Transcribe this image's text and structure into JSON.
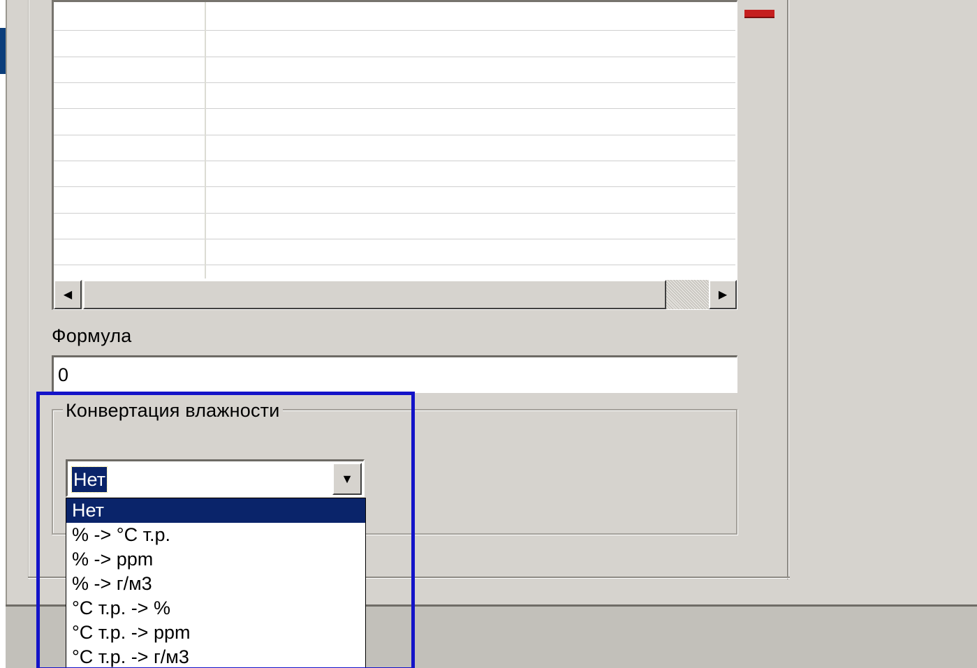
{
  "formula": {
    "label": "Формула",
    "value": "0"
  },
  "humidity_conversion": {
    "title": "Конвертация влажности",
    "selected": "Нет",
    "options": [
      "Нет",
      "% -> °С т.р.",
      "% -> ppm",
      "% -> г/м3",
      "°С т.р. -> %",
      "°С т.р. -> ppm",
      "°С т.р. -> г/м3"
    ]
  },
  "icons": {
    "scroll_left": "◀",
    "scroll_right": "▶",
    "dropdown_arrow": "▼"
  },
  "colors": {
    "selection": "#0a246a",
    "highlight_annotation": "#1313c8",
    "window_face": "#d6d3ce"
  }
}
